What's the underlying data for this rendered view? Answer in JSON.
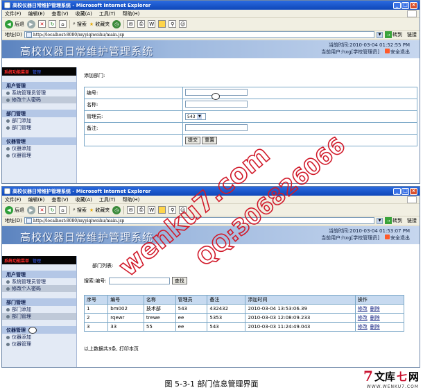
{
  "window1": {
    "title": "高校仪器日常维护管理系统 - Microsoft Internet Explorer",
    "address": "http://localhost:8080/myyiqiweihu/main.jsp",
    "datetime": "当前时间:2010-03-04 01:52:55 PM",
    "page_title": "添加部门:",
    "form": {
      "labels": [
        "编号:",
        "名称:",
        "管理员:",
        "备注:"
      ],
      "admin_value": "543",
      "submit_label": "提交",
      "reset_label": "重置"
    }
  },
  "window2": {
    "title": "高校仪器日常维护管理系统 - Microsoft Internet Explorer",
    "address": "http://localhost:8080/myyiqiweihu/main.jsp",
    "datetime": "当前时间:2010-03-04 01:53:07 PM",
    "page_title": "部门列表:",
    "search_label": "搜索:编号:",
    "search_button": "查找",
    "table": {
      "headers": [
        "序号",
        "编号",
        "名称",
        "管理员",
        "备注",
        "添加时间",
        "操作"
      ],
      "rows": [
        [
          "1",
          "bm002",
          "技术部",
          "543",
          "432432",
          "2010-03-04 13:53:06.39"
        ],
        [
          "2",
          "rqewr",
          "trewe",
          "ee",
          "5353",
          "2010-03-03 12:08:09.233"
        ],
        [
          "3",
          "33",
          "55",
          "ee",
          "543",
          "2010-03-03 11:24:49.043"
        ]
      ],
      "edit_label": "修改",
      "delete_label": "删除"
    },
    "footer": "以上数据共3条, 打印本页"
  },
  "browser": {
    "menu": [
      "文件(F)",
      "编辑(E)",
      "查看(V)",
      "收藏(A)",
      "工具(T)",
      "帮助(H)"
    ],
    "back": "后退",
    "search": "搜索",
    "favorites": "收藏夹",
    "addr_label": "地址(D)",
    "go": "转到",
    "links": "链接"
  },
  "app": {
    "banner": "高校仪器日常维护管理系统",
    "user": "当前用户:hxg[学校管理员]",
    "logout": "安全退出",
    "sidebar_header_red": "系统功能菜单",
    "sidebar_header_blue": "管理",
    "groups": [
      {
        "title": "用户管理",
        "items": [
          "系统管理员管理",
          "修改个人密码"
        ]
      },
      {
        "title": "部门管理",
        "items": [
          "部门添加",
          "部门管理"
        ]
      },
      {
        "title": "仪器管理",
        "items": [
          "仪器添加",
          "仪器管理"
        ]
      }
    ]
  },
  "caption": "图 5-3-1 部门信息管理界面",
  "watermark": {
    "text1": "wenku7.com",
    "text2": "QQ:306826066"
  },
  "logo": {
    "mark": "7",
    "name1": "文库",
    "name2": "七",
    "name3": "网",
    "url": "WWW.WENKU7.COM"
  },
  "colors": {
    "titlebar": "#0f47b8",
    "banner": "#5b83bf",
    "sidebar": "#e3eaf5",
    "table_header": "#c7daf0",
    "watermark": "#d11a2a"
  }
}
